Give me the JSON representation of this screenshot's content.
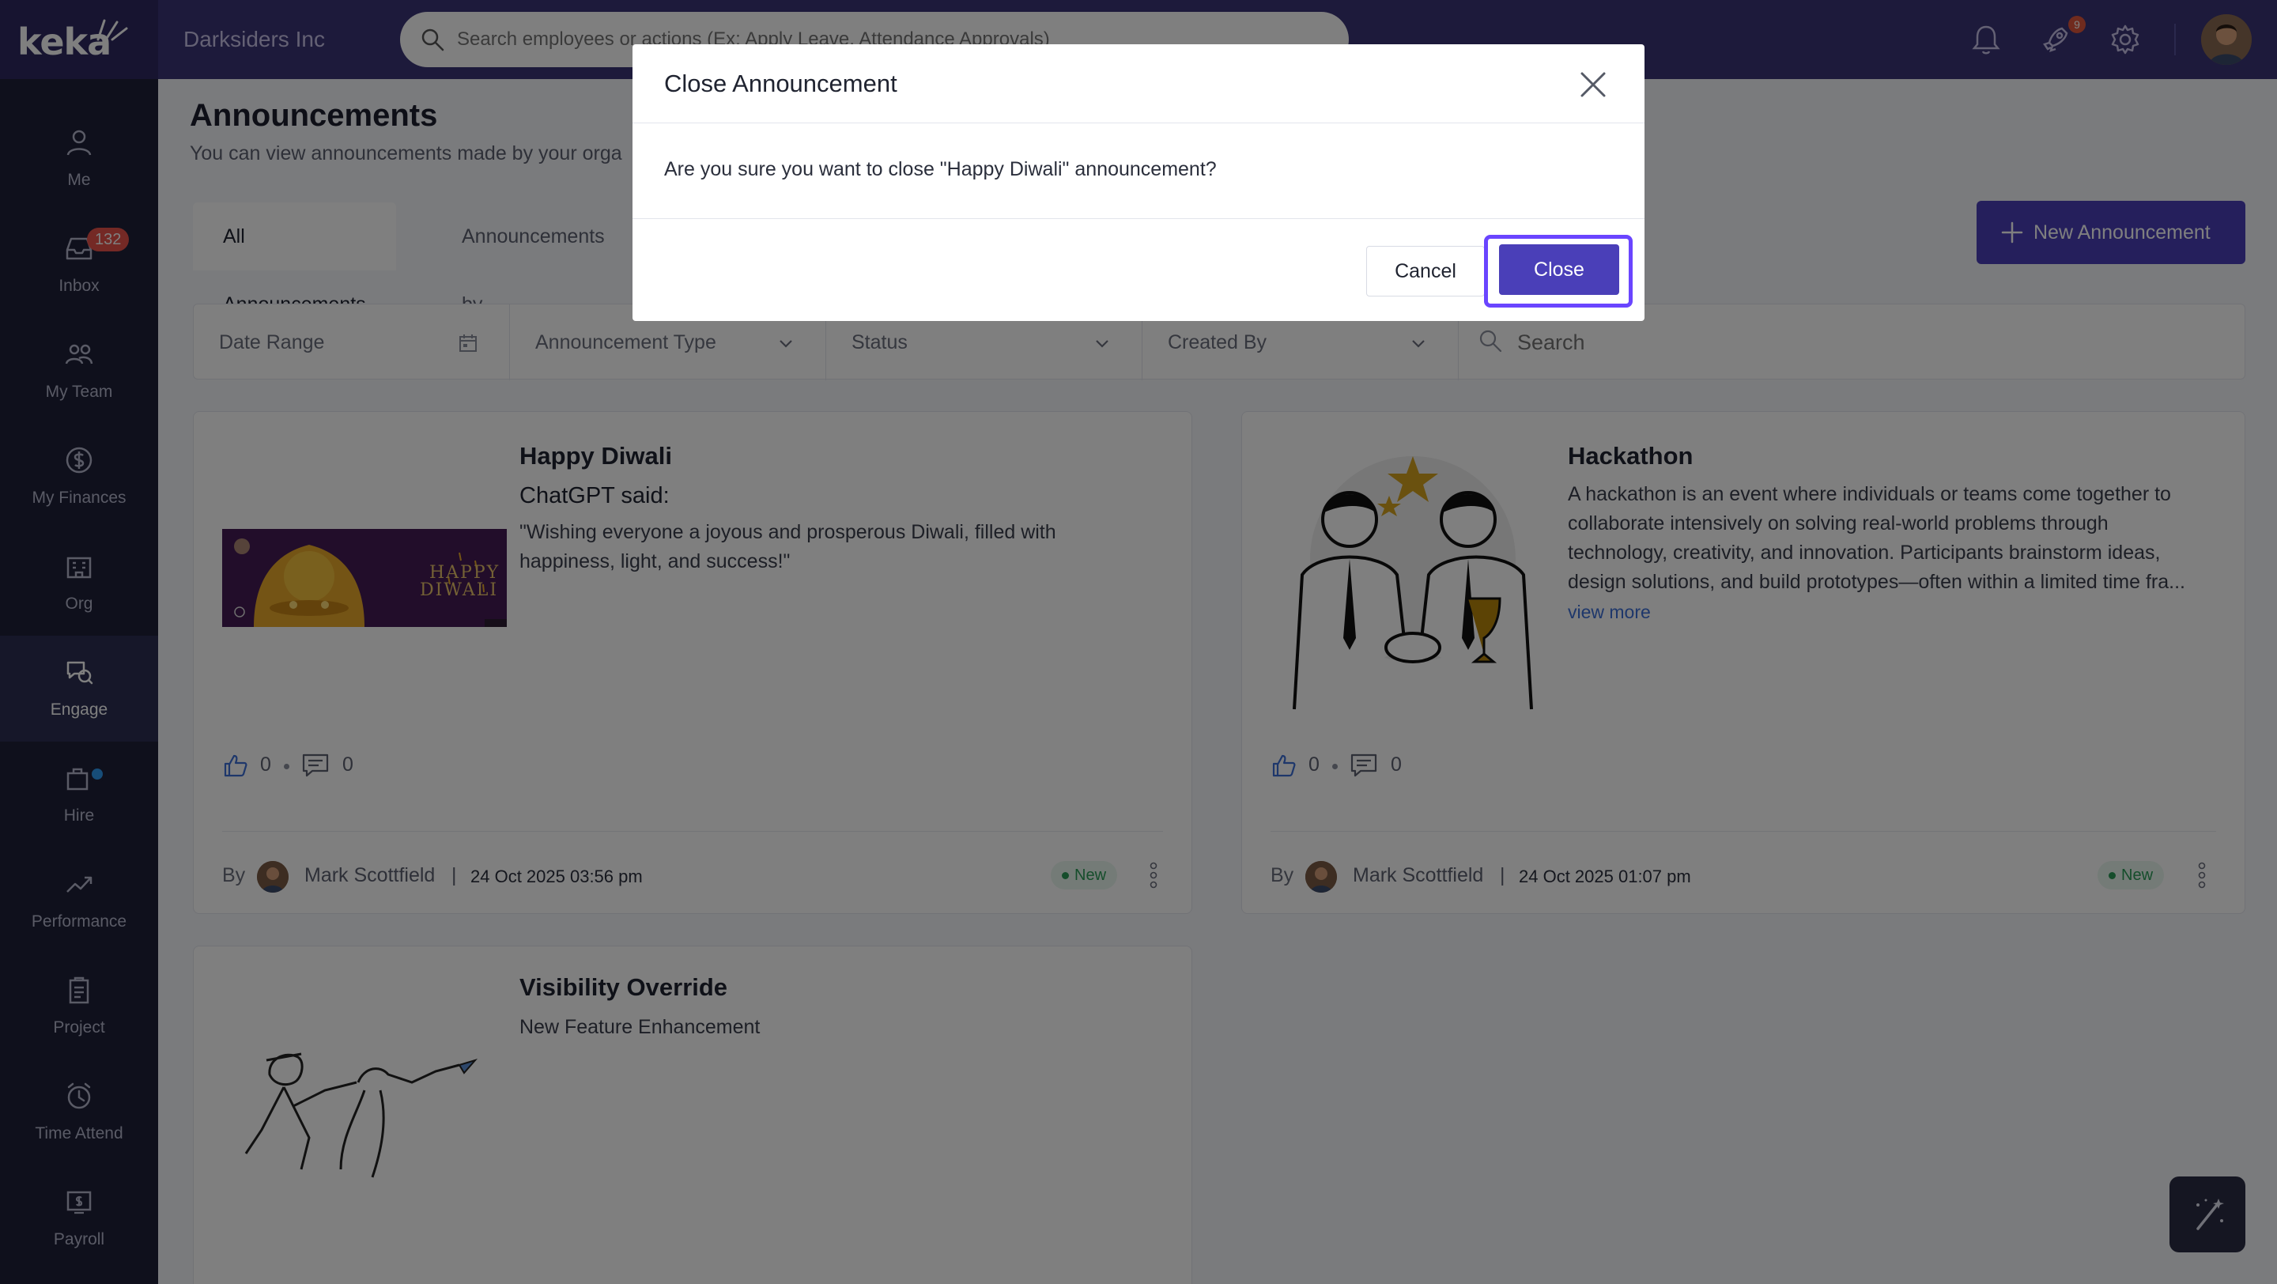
{
  "header": {
    "logo_text": "keka",
    "company": "Darksiders Inc",
    "search_placeholder": "Search employees or actions (Ex: Apply Leave, Attendance Approvals)",
    "rocket_badge": "9"
  },
  "sidebar": {
    "items": [
      {
        "label": "Me",
        "icon": "user-icon"
      },
      {
        "label": "Inbox",
        "icon": "inbox-icon",
        "badge": "132"
      },
      {
        "label": "My Team",
        "icon": "team-icon"
      },
      {
        "label": "My Finances",
        "icon": "dollar-icon"
      },
      {
        "label": "Org",
        "icon": "org-icon"
      },
      {
        "label": "Engage",
        "icon": "engage-icon",
        "active": true
      },
      {
        "label": "Hire",
        "icon": "hire-icon"
      },
      {
        "label": "Performance",
        "icon": "trend-icon"
      },
      {
        "label": "Project",
        "icon": "clipboard-icon"
      },
      {
        "label": "Time Attend",
        "icon": "clock-icon"
      },
      {
        "label": "Payroll",
        "icon": "payroll-icon"
      }
    ]
  },
  "page": {
    "title": "Announcements",
    "subtitle": "You can view announcements made by your orga",
    "tabs": [
      {
        "label": "All Announcements",
        "active": true
      },
      {
        "label": "Announcements by"
      }
    ],
    "new_button": "New Announcement"
  },
  "filters": {
    "date_range": "Date Range",
    "announcement_type": "Announcement Type",
    "status": "Status",
    "created_by": "Created By",
    "search_placeholder": "Search"
  },
  "cards": [
    {
      "title": "Happy Diwali",
      "subtitle": "ChatGPT said:",
      "body_line1": "\"Wishing everyone a joyous and prosperous Diwali, filled with",
      "body_line2": "happiness, light, and success!\"",
      "image_text_1": "HAPPY",
      "image_text_2": "DIWALI",
      "likes": "0",
      "comments": "0",
      "by": "By",
      "author": "Mark Scottfield",
      "date": "24 Oct 2025 03:56 pm",
      "status": "New"
    },
    {
      "title": "Hackathon",
      "body_line1": "A hackathon is an event where individuals or teams come together to",
      "body_line2": "collaborate intensively on solving real-world problems through",
      "body_line3": "technology, creativity, and innovation. Participants brainstorm ideas,",
      "body_line4": "design solutions, and build prototypes—often within a limited time fra...",
      "view_more": "view more",
      "likes": "0",
      "comments": "0",
      "by": "By",
      "author": "Mark Scottfield",
      "date": "24 Oct 2025 01:07 pm",
      "status": "New"
    },
    {
      "title": "Visibility Override",
      "subtitle": "New Feature Enhancement"
    }
  ],
  "modal": {
    "title": "Close Announcement",
    "message": "Are you sure you want to close \"Happy Diwali\" announcement?",
    "cancel": "Cancel",
    "confirm": "Close"
  },
  "colors": {
    "topbar": "#3b3476",
    "sidebar": "#1e2039",
    "accent": "#4a3fb8",
    "focus_ring": "#6a45ff",
    "status_new": "#2a9b57"
  }
}
